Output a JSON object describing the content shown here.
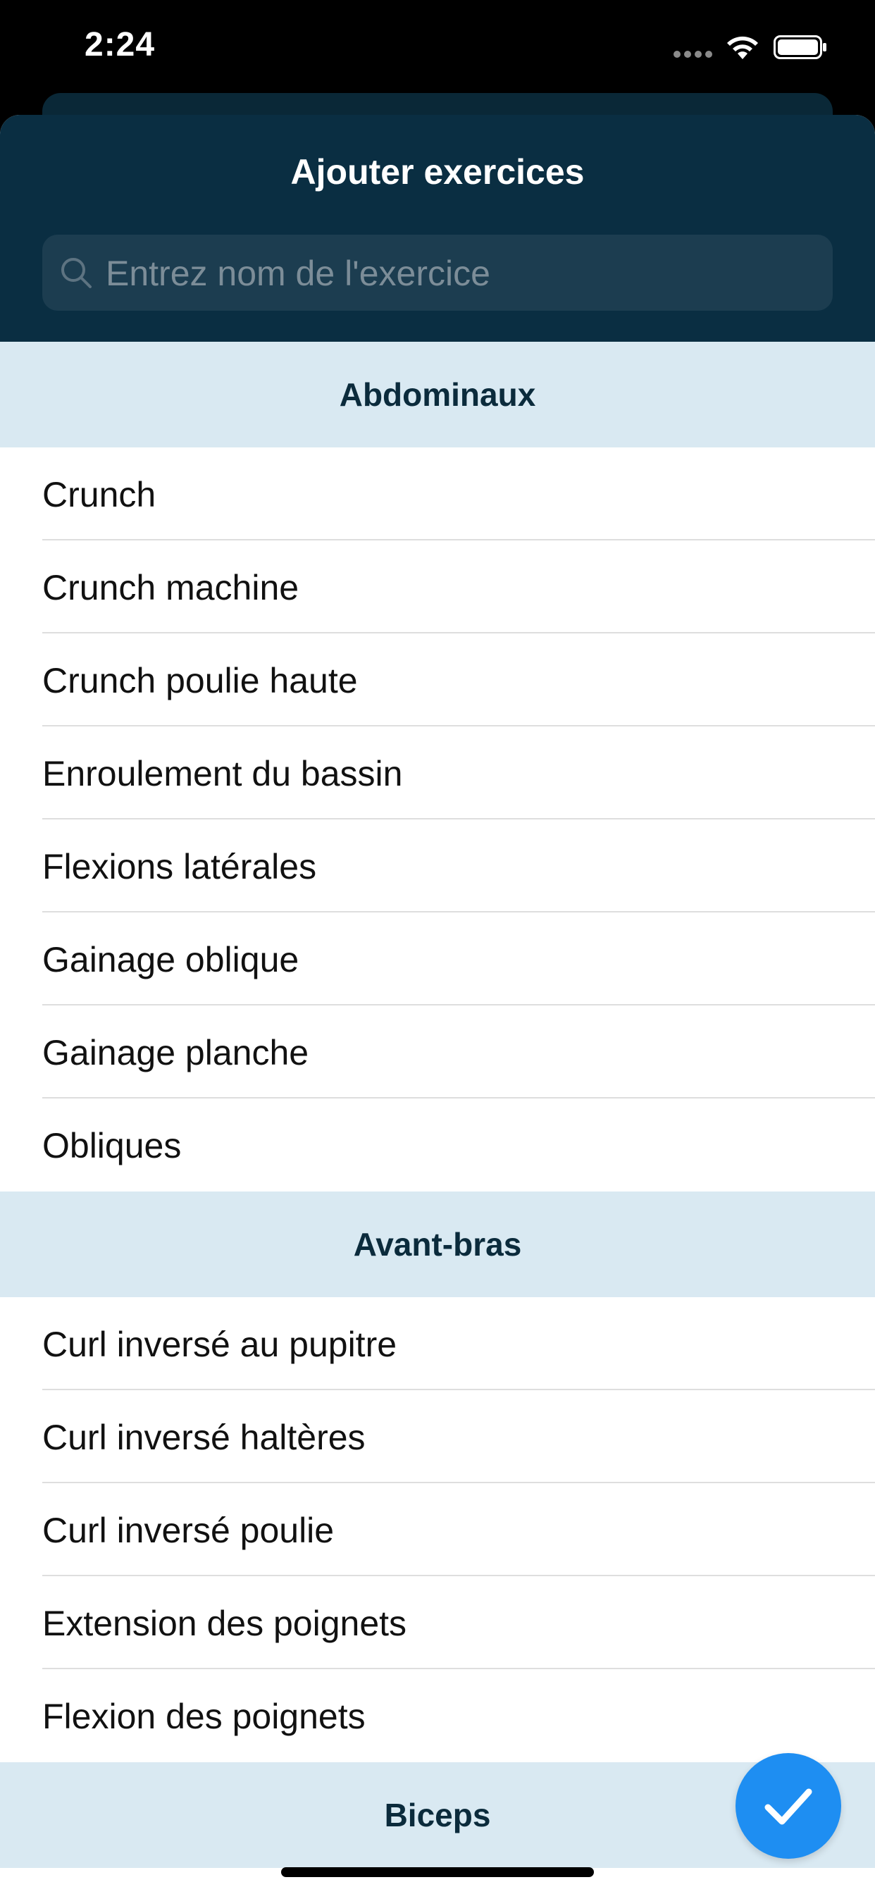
{
  "status_bar": {
    "time": "2:24"
  },
  "sheet": {
    "title": "Ajouter exercices",
    "search": {
      "placeholder": "Entrez nom de l'exercice",
      "icon": "search-icon"
    }
  },
  "sections": [
    {
      "title": "Abdominaux",
      "items": [
        "Crunch",
        "Crunch machine",
        "Crunch poulie haute",
        "Enroulement du bassin",
        "Flexions latérales",
        "Gainage oblique",
        "Gainage planche",
        "Obliques"
      ]
    },
    {
      "title": "Avant-bras",
      "items": [
        "Curl inversé au pupitre",
        "Curl inversé haltères",
        "Curl inversé poulie",
        "Extension des poignets",
        "Flexion des poignets"
      ]
    },
    {
      "title": "Biceps",
      "items": []
    }
  ],
  "confirm_button": {
    "icon": "checkmark-icon"
  },
  "colors": {
    "header_bg": "#0a2e42",
    "section_bg": "#d9e9f2",
    "accent": "#1e8ef2"
  }
}
